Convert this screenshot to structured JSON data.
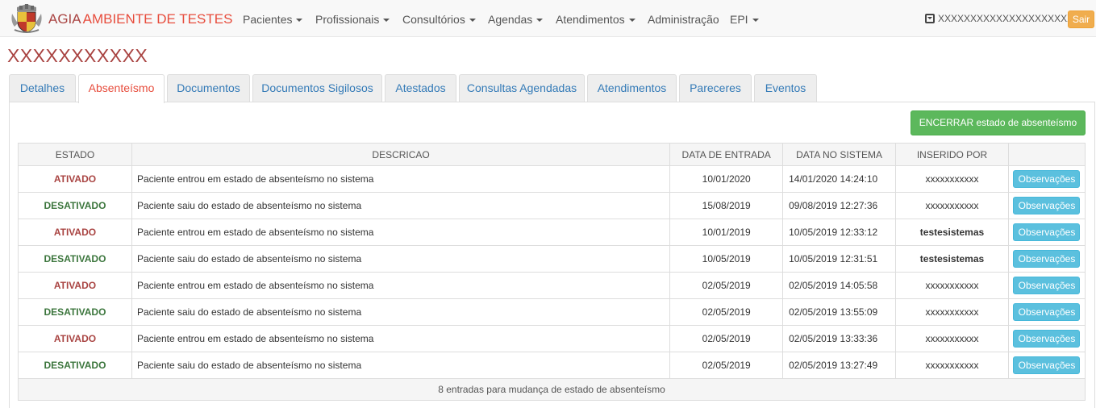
{
  "brand": {
    "part1": "AGIA",
    "part2": "AMBIENTE DE TESTES"
  },
  "nav": [
    {
      "label": "Pacientes",
      "dropdown": true
    },
    {
      "label": "Profissionais",
      "dropdown": true
    },
    {
      "label": "Consultórios",
      "dropdown": true
    },
    {
      "label": "Agendas",
      "dropdown": true
    },
    {
      "label": "Atendimentos",
      "dropdown": true
    },
    {
      "label": "Administração",
      "dropdown": false
    },
    {
      "label": "EPI",
      "dropdown": true
    }
  ],
  "user": {
    "icon": "caret-square-icon",
    "name": "XXXXXXXXXXXXXXXXXXXXXX",
    "logout_label": "Sair"
  },
  "page_title": "XXXXXXXXXXX",
  "tabs": [
    {
      "label": "Detalhes"
    },
    {
      "label": "Absenteísmo",
      "active": true
    },
    {
      "label": "Documentos"
    },
    {
      "label": "Documentos Sigilosos"
    },
    {
      "label": "Atestados"
    },
    {
      "label": "Consultas Agendadas"
    },
    {
      "label": "Atendimentos"
    },
    {
      "label": "Pareceres"
    },
    {
      "label": "Eventos"
    }
  ],
  "end_button_label": "ENCERRAR estado de absenteísmo",
  "table": {
    "headers": [
      "ESTADO",
      "DESCRICAO",
      "DATA DE ENTRADA",
      "DATA NO SISTEMA",
      "INSERIDO POR",
      ""
    ],
    "rows": [
      {
        "estado": "ATIVADO",
        "active": true,
        "descricao": "Paciente entrou em estado de absenteísmo no sistema",
        "entrada": "10/01/2020",
        "sistema": "14/01/2020 14:24:10",
        "inserido": "xxxxxxxxxxx",
        "bold": false,
        "action": "Observações"
      },
      {
        "estado": "DESATIVADO",
        "active": false,
        "descricao": "Paciente saiu do estado de absenteísmo no sistema",
        "entrada": "15/08/2019",
        "sistema": "09/08/2019 12:27:36",
        "inserido": "xxxxxxxxxxx",
        "bold": false,
        "action": "Observações"
      },
      {
        "estado": "ATIVADO",
        "active": true,
        "descricao": "Paciente entrou em estado de absenteísmo no sistema",
        "entrada": "10/01/2019",
        "sistema": "10/05/2019 12:33:12",
        "inserido": "testesistemas",
        "bold": true,
        "action": "Observações"
      },
      {
        "estado": "DESATIVADO",
        "active": false,
        "descricao": "Paciente saiu do estado de absenteísmo no sistema",
        "entrada": "10/05/2019",
        "sistema": "10/05/2019 12:31:51",
        "inserido": "testesistemas",
        "bold": true,
        "action": "Observações"
      },
      {
        "estado": "ATIVADO",
        "active": true,
        "descricao": "Paciente entrou em estado de absenteísmo no sistema",
        "entrada": "02/05/2019",
        "sistema": "02/05/2019 14:05:58",
        "inserido": "xxxxxxxxxxx",
        "bold": false,
        "action": "Observações"
      },
      {
        "estado": "DESATIVADO",
        "active": false,
        "descricao": "Paciente saiu do estado de absenteísmo no sistema",
        "entrada": "02/05/2019",
        "sistema": "02/05/2019 13:55:09",
        "inserido": "xxxxxxxxxxx",
        "bold": false,
        "action": "Observações"
      },
      {
        "estado": "ATIVADO",
        "active": true,
        "descricao": "Paciente entrou em estado de absenteísmo no sistema",
        "entrada": "02/05/2019",
        "sistema": "02/05/2019 13:33:36",
        "inserido": "xxxxxxxxxxx",
        "bold": false,
        "action": "Observações"
      },
      {
        "estado": "DESATIVADO",
        "active": false,
        "descricao": "Paciente saiu do estado de absenteísmo no sistema",
        "entrada": "02/05/2019",
        "sistema": "02/05/2019 13:27:49",
        "inserido": "xxxxxxxxxxx",
        "bold": false,
        "action": "Observações"
      }
    ],
    "footer": "8 entradas para mudança de estado de absenteísmo"
  },
  "colors": {
    "brand_red": "#a94442",
    "accent_red": "#e74c3c",
    "active": "#a94442",
    "inactive": "#3c763d",
    "success_btn": "#5cb85c",
    "info_btn": "#5bc0de",
    "warning_btn": "#f0ad4e",
    "link": "#337ab7"
  }
}
